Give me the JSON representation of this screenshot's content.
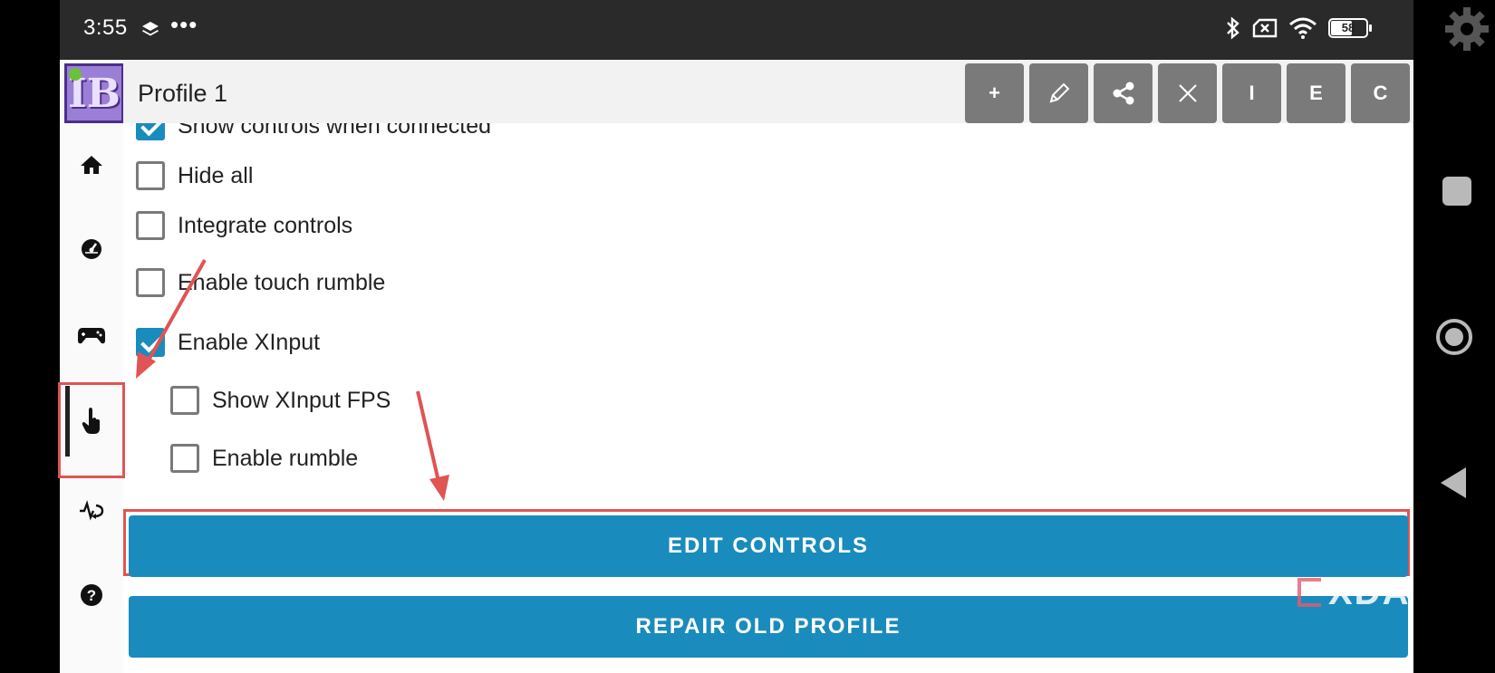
{
  "status_bar": {
    "time": "3:55",
    "more": "•••",
    "battery": "58"
  },
  "header": {
    "title": "Profile 1",
    "toolbar": {
      "add": "+",
      "edit": "✎",
      "share": "share-icon",
      "delete": "✕",
      "import": "I",
      "export": "E",
      "copy": "C"
    }
  },
  "sidebar": {
    "logo": "IB",
    "items": [
      {
        "icon": "home-icon"
      },
      {
        "icon": "gauge-icon"
      },
      {
        "icon": "gamepad-icon"
      },
      {
        "icon": "touch-icon",
        "active": true
      },
      {
        "icon": "pulse-icon"
      },
      {
        "icon": "help-icon"
      }
    ]
  },
  "options": [
    {
      "label": "Show controls when connected",
      "checked": true
    },
    {
      "label": "Hide all",
      "checked": false
    },
    {
      "label": "Integrate controls",
      "checked": false
    },
    {
      "label": "Enable touch rumble",
      "checked": false
    },
    {
      "label": "Enable XInput",
      "checked": true
    },
    {
      "label": "Show XInput FPS",
      "checked": false
    },
    {
      "label": "Enable rumble",
      "checked": false
    }
  ],
  "buttons": {
    "edit_controls": "EDIT CONTROLS",
    "repair_old_profile": "REPAIR OLD PROFILE"
  },
  "watermark": "XDA",
  "colors": {
    "accent": "#1a8bbd",
    "toolbar_button": "#7a7a7a",
    "highlight": "#e05454"
  }
}
